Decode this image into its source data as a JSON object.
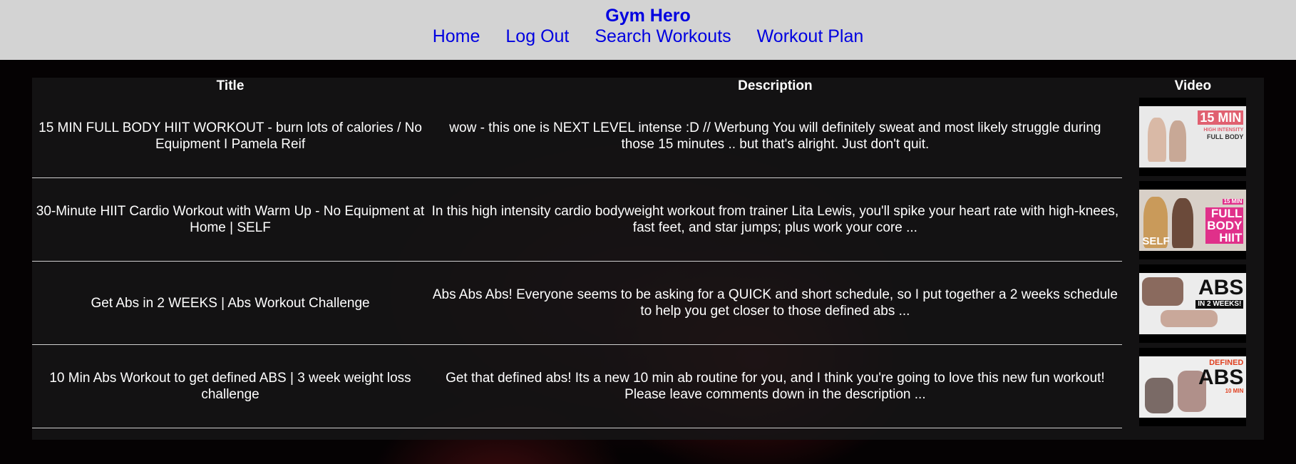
{
  "header": {
    "brand": "Gym Hero",
    "nav": [
      "Home",
      "Log Out",
      "Search Workouts",
      "Workout Plan"
    ]
  },
  "table": {
    "headers": [
      "Title",
      "Description",
      "Video"
    ],
    "rows": [
      {
        "title": "15 MIN FULL BODY HIIT WORKOUT - burn lots of calories / No Equipment I Pamela Reif",
        "description": "wow - this one is NEXT LEVEL intense :D // Werbung You will definitely sweat and most likely struggle during those 15 minutes .. but that's alright. Just don't quit.",
        "thumb": {
          "lines": [
            "15 MIN",
            "HIGH INTENSITY",
            "FULL BODY"
          ],
          "bg": "#e9e9e9",
          "accent": "#e06070"
        }
      },
      {
        "title": "30-Minute HIIT Cardio Workout with Warm Up - No Equipment at Home | SELF",
        "description": "In this high intensity cardio bodyweight workout from trainer Lita Lewis, you'll spike your heart rate with high-knees, fast feet, and star jumps; plus work your core ...",
        "thumb": {
          "lines": [
            "15 MIN",
            "FULL",
            "BODY",
            "HIIT",
            "SELF"
          ],
          "bg": "#d8d0c8",
          "accent": "#e0308a"
        }
      },
      {
        "title": "Get Abs in 2 WEEKS | Abs Workout Challenge",
        "description": "Abs Abs Abs! Everyone seems to be asking for a QUICK and short schedule, so I put together a 2 weeks schedule to help you get closer to those defined abs ...",
        "thumb": {
          "lines": [
            "ABS",
            "IN 2 WEEKS!"
          ],
          "bg": "#ececec",
          "accent": "#111111"
        }
      },
      {
        "title": "10 Min Abs Workout to get defined ABS | 3 week weight loss challenge",
        "description": "Get that defined abs! Its a new 10 min ab routine for you, and I think you're going to love this new fun workout! Please leave comments down in the description ...",
        "thumb": {
          "lines": [
            "DEFINED",
            "ABS",
            "10 MIN"
          ],
          "bg": "#eeeeee",
          "accent": "#e04020"
        }
      }
    ]
  }
}
